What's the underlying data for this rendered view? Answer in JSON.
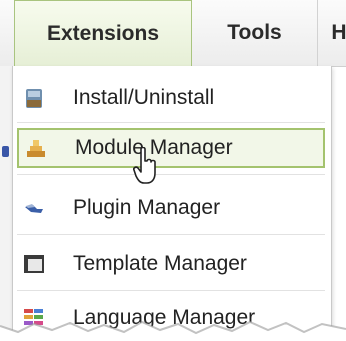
{
  "menubar": {
    "tabs": [
      {
        "label": "Extensions"
      },
      {
        "label": "Tools"
      },
      {
        "label": "H"
      }
    ]
  },
  "menu": {
    "items": [
      {
        "label": "Install/Uninstall",
        "icon": "install-icon"
      },
      {
        "label": "Module Manager",
        "icon": "module-icon"
      },
      {
        "label": "Plugin Manager",
        "icon": "plugin-icon"
      },
      {
        "label": "Template Manager",
        "icon": "template-icon"
      },
      {
        "label": "Language Manager",
        "icon": "language-icon"
      }
    ],
    "selected_label": "Module Manager"
  },
  "colors": {
    "accent_border": "#a4c36e",
    "selected_bg": "#f2f7e8"
  }
}
